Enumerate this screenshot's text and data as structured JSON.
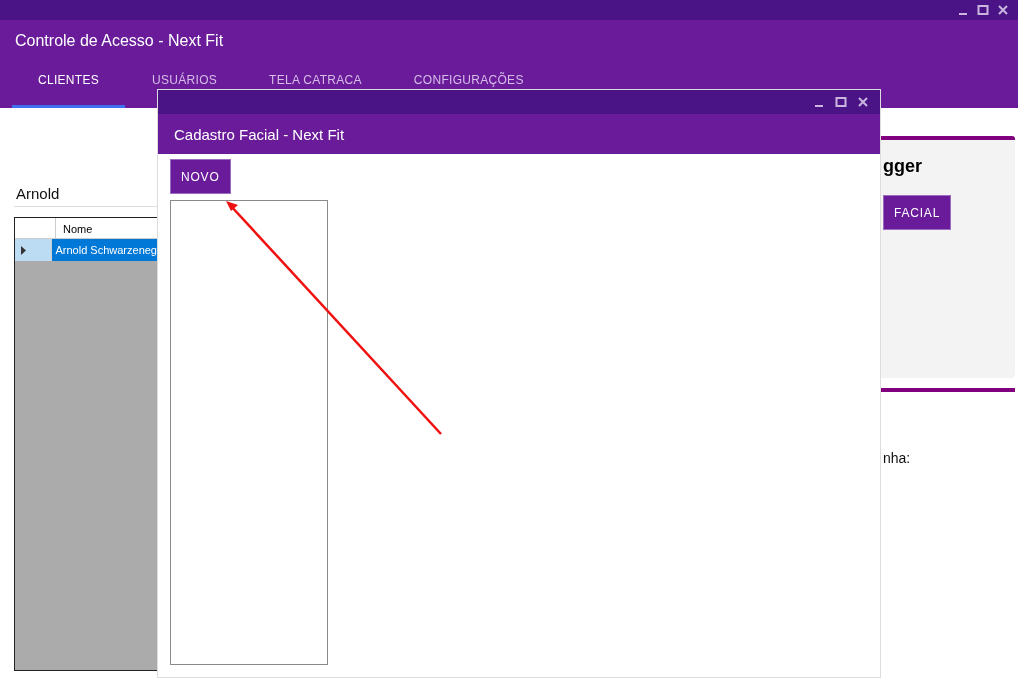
{
  "window": {
    "title": "Controle de Acesso - Next Fit"
  },
  "tabs": [
    {
      "label": "CLIENTES",
      "selected": true
    },
    {
      "label": "USUÁRIOS",
      "selected": false
    },
    {
      "label": "TELA CATRACA",
      "selected": false
    },
    {
      "label": "CONFIGURAÇÕES",
      "selected": false
    }
  ],
  "clients": {
    "search": "Arnold",
    "table": {
      "columns": [
        "Nome"
      ],
      "rows": [
        {
          "name": "Arnold Schwarzeneg",
          "selected": true
        }
      ]
    }
  },
  "client_card": {
    "name": "gger",
    "button": "FACIAL",
    "field_label": "nha:"
  },
  "dialog": {
    "title": "Cadastro Facial - Next Fit",
    "button": "NOVO"
  }
}
